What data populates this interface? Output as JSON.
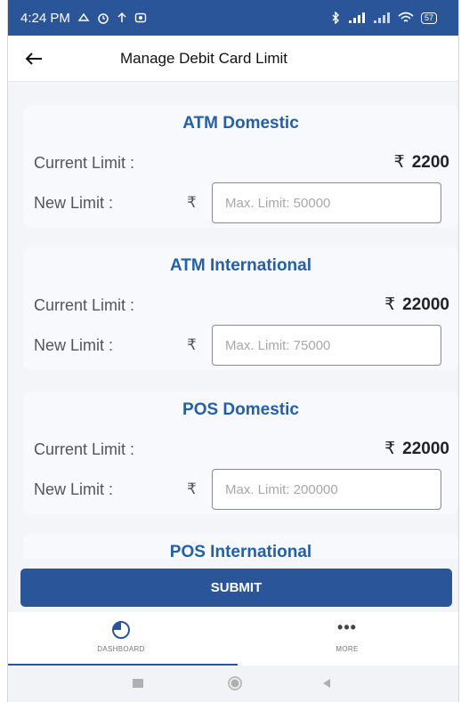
{
  "status_bar": {
    "time": "4:24 PM",
    "battery": "57"
  },
  "header": {
    "title": "Manage Debit Card Limit",
    "back_icon": "arrow-left-icon"
  },
  "currency_symbol": "₹",
  "cards": [
    {
      "title": "ATM Domestic",
      "current_label": "Current Limit :",
      "current_value": "2200",
      "new_label": "New Limit :",
      "placeholder": "Max. Limit: 50000"
    },
    {
      "title": "ATM International",
      "current_label": "Current Limit :",
      "current_value": "22000",
      "new_label": "New Limit :",
      "placeholder": "Max. Limit: 75000"
    },
    {
      "title": "POS Domestic",
      "current_label": "Current Limit :",
      "current_value": "22000",
      "new_label": "New Limit :",
      "placeholder": "Max. Limit: 200000"
    },
    {
      "title": "POS International"
    }
  ],
  "submit_label": "SUBMIT",
  "bottom_nav": {
    "dashboard_label": "DASHBOARD",
    "more_label": "MORE",
    "more_icon": "•••"
  },
  "colors": {
    "primary": "#2a5699",
    "title_blue": "#2460a7",
    "background": "#f3f5f9"
  }
}
